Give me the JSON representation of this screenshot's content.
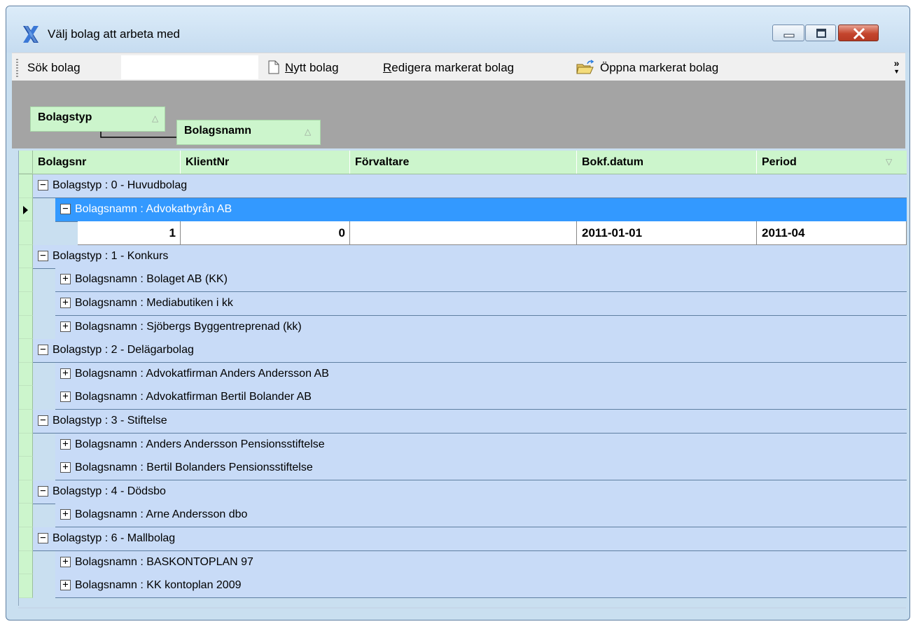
{
  "window": {
    "title": "Välj bolag att arbeta med",
    "icon": "x-logo-icon",
    "controls": [
      "minimize-icon",
      "maximize-icon",
      "close-icon"
    ]
  },
  "toolbar": {
    "search_label": "Sök bolag",
    "search_value": "",
    "new_company": {
      "mnemonic": "N",
      "rest": "ytt bolag"
    },
    "edit_company": {
      "mnemonic": "R",
      "rest": "edigera markerat bolag"
    },
    "open_company": {
      "text": "Öppna markerat bolag"
    },
    "overflow": "»"
  },
  "grouping": {
    "chips": [
      {
        "label": "Bolagstyp",
        "sort": "△"
      },
      {
        "label": "Bolagsnamn",
        "sort": "△"
      }
    ]
  },
  "grid": {
    "columns": [
      {
        "label": "Bolagsnr"
      },
      {
        "label": "KlientNr"
      },
      {
        "label": "Förvaltare"
      },
      {
        "label": "Bokf.datum"
      },
      {
        "label": "Period",
        "sort": "▽"
      }
    ],
    "rows": [
      {
        "kind": "group",
        "level": 0,
        "expander": "−",
        "text": "Bolagstyp : 0 - Huvudbolag"
      },
      {
        "kind": "group",
        "level": 1,
        "expander": "−",
        "text": "Bolagsnamn : Advokatbyrån AB",
        "selected": true,
        "current": true
      },
      {
        "kind": "data",
        "cells": [
          "1",
          "0",
          "",
          "2011-01-01",
          "2011-04"
        ]
      },
      {
        "kind": "group",
        "level": 0,
        "expander": "−",
        "text": "Bolagstyp : 1 - Konkurs"
      },
      {
        "kind": "group",
        "level": 1,
        "expander": "+",
        "text": "Bolagsnamn : Bolaget AB (KK)"
      },
      {
        "kind": "group",
        "level": 1,
        "expander": "+",
        "text": "Bolagsnamn : Mediabutiken i kk"
      },
      {
        "kind": "group",
        "level": 1,
        "expander": "+",
        "text": "Bolagsnamn : Sjöbergs Byggentreprenad (kk)"
      },
      {
        "kind": "group",
        "level": 0,
        "expander": "−",
        "text": "Bolagstyp : 2 - Delägarbolag"
      },
      {
        "kind": "group",
        "level": 1,
        "expander": "+",
        "text": "Bolagsnamn : Advokatfirman Anders Andersson AB"
      },
      {
        "kind": "group",
        "level": 1,
        "expander": "+",
        "text": "Bolagsnamn : Advokatfirman Bertil Bolander AB"
      },
      {
        "kind": "group",
        "level": 0,
        "expander": "−",
        "text": "Bolagstyp : 3 - Stiftelse"
      },
      {
        "kind": "group",
        "level": 1,
        "expander": "+",
        "text": "Bolagsnamn : Anders Andersson Pensionsstiftelse"
      },
      {
        "kind": "group",
        "level": 1,
        "expander": "+",
        "text": "Bolagsnamn : Bertil Bolanders Pensionsstiftelse"
      },
      {
        "kind": "group",
        "level": 0,
        "expander": "−",
        "text": "Bolagstyp : 4 - Dödsbo"
      },
      {
        "kind": "group",
        "level": 1,
        "expander": "+",
        "text": "Bolagsnamn : Arne Andersson dbo"
      },
      {
        "kind": "group",
        "level": 0,
        "expander": "−",
        "text": "Bolagstyp : 6 - Mallbolag"
      },
      {
        "kind": "group",
        "level": 1,
        "expander": "+",
        "text": "Bolagsnamn : BASKONTOPLAN 97"
      },
      {
        "kind": "group",
        "level": 1,
        "expander": "+",
        "text": "Bolagsnamn : KK kontoplan 2009"
      }
    ]
  }
}
